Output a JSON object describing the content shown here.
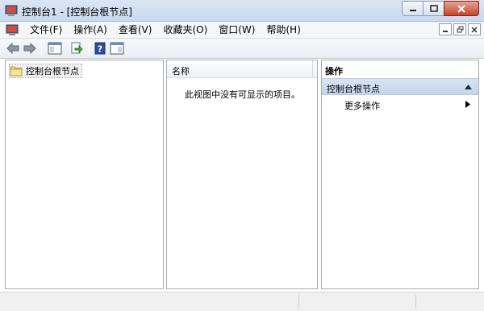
{
  "window": {
    "title": "控制台1 - [控制台根节点]",
    "app_icon": "mmc-console-icon",
    "controls": [
      "minimize-icon",
      "maximize-icon",
      "close-icon"
    ]
  },
  "menubar": {
    "items": [
      {
        "label": "文件(F)"
      },
      {
        "label": "操作(A)"
      },
      {
        "label": "查看(V)"
      },
      {
        "label": "收藏夹(O)"
      },
      {
        "label": "窗口(W)"
      },
      {
        "label": "帮助(H)"
      }
    ],
    "mdi_controls": [
      "minimize-icon",
      "restore-icon",
      "close-icon"
    ]
  },
  "toolbar": {
    "buttons": [
      "back-arrow-icon",
      "forward-arrow-icon",
      "show-hide-tree-icon",
      "export-list-icon",
      "help-icon",
      "show-hide-action-pane-icon"
    ]
  },
  "tree": {
    "root_label": "控制台根节点",
    "root_icon": "folder-icon"
  },
  "list": {
    "column_name": "名称",
    "empty_message": "此视图中没有可显示的项目。"
  },
  "actions": {
    "title": "操作",
    "section_label": "控制台根节点",
    "more_actions_label": "更多操作"
  },
  "colors": {
    "title_bar": "#c9d9ee",
    "section_header": "#c4d5ea",
    "close_button": "#c4442c",
    "folder": "#f5d77e"
  }
}
